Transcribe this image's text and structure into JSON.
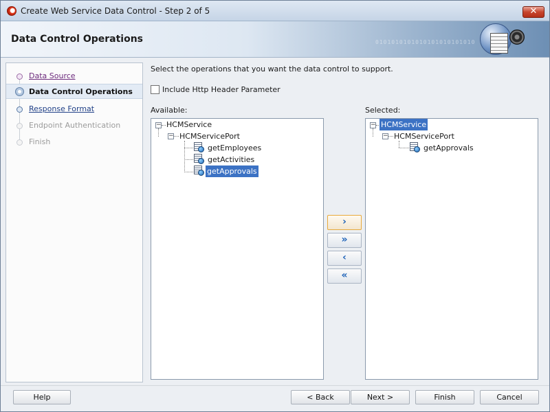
{
  "window": {
    "title": "Create Web Service Data Control - Step 2 of 5",
    "close_glyph": "✕"
  },
  "header": {
    "title": "Data Control Operations",
    "art_binary": "0101010101010101010101010"
  },
  "nav": {
    "items": [
      {
        "label": "Data Source",
        "state": "visited"
      },
      {
        "label": "Data Control Operations",
        "state": "current"
      },
      {
        "label": "Response Format ",
        "state": "link"
      },
      {
        "label": "Endpoint Authentication",
        "state": "disabled"
      },
      {
        "label": "Finish",
        "state": "disabled"
      }
    ]
  },
  "main": {
    "instruction": "Select the operations that you want the data control to support.",
    "checkbox": {
      "label": "Include Http Header Parameter",
      "checked": false
    },
    "available": {
      "label": "Available:",
      "tree": {
        "service": "HCMService",
        "port": "HCMServicePort",
        "operations": [
          "getEmployees",
          "getActivities",
          "getApprovals"
        ],
        "selected_operation": "getApprovals"
      }
    },
    "selected": {
      "label": "Selected:",
      "tree": {
        "service": "HCMService",
        "port": "HCMServicePort",
        "operations": [
          "getApprovals"
        ],
        "selected_node": "HCMService"
      }
    },
    "shuttle": {
      "move_one": "›",
      "move_all": "»",
      "remove_one": "‹",
      "remove_all": "«"
    },
    "tree_toggle": "−"
  },
  "footer": {
    "help": "Help",
    "back": "< Back",
    "next": "Next >",
    "finish": "Finish",
    "cancel": "Cancel"
  },
  "icons": {
    "app": "oracle-jdeveloper-icon",
    "operation": "web-service-operation-icon",
    "accent_color": "#3c72c4"
  }
}
